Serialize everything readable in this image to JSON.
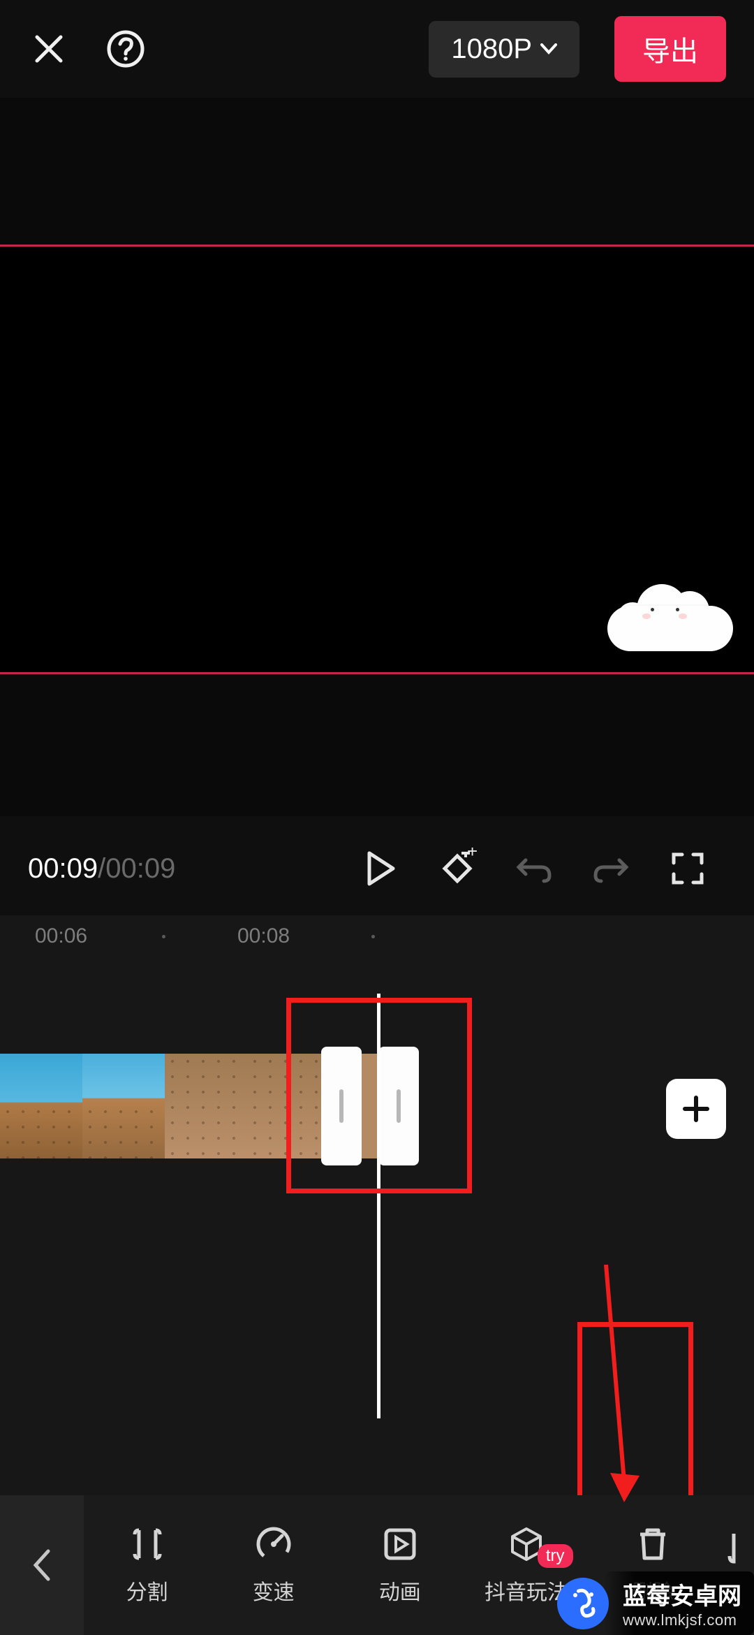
{
  "header": {
    "resolution": "1080P",
    "export": "导出"
  },
  "transport": {
    "current_time": "00:09",
    "separator": " / ",
    "total_time": "00:09"
  },
  "ruler": {
    "marks": [
      "00:06",
      "00:08"
    ]
  },
  "tools": {
    "split": "分割",
    "speed": "变速",
    "animation": "动画",
    "douyin": "抖音玩法",
    "delete": "删除",
    "try_badge": "try"
  },
  "watermark": {
    "main": "蓝莓安卓网",
    "sub": "www.lmkjsf.com"
  },
  "colors": {
    "accent": "#f12b56",
    "highlight": "#f21e1e"
  }
}
